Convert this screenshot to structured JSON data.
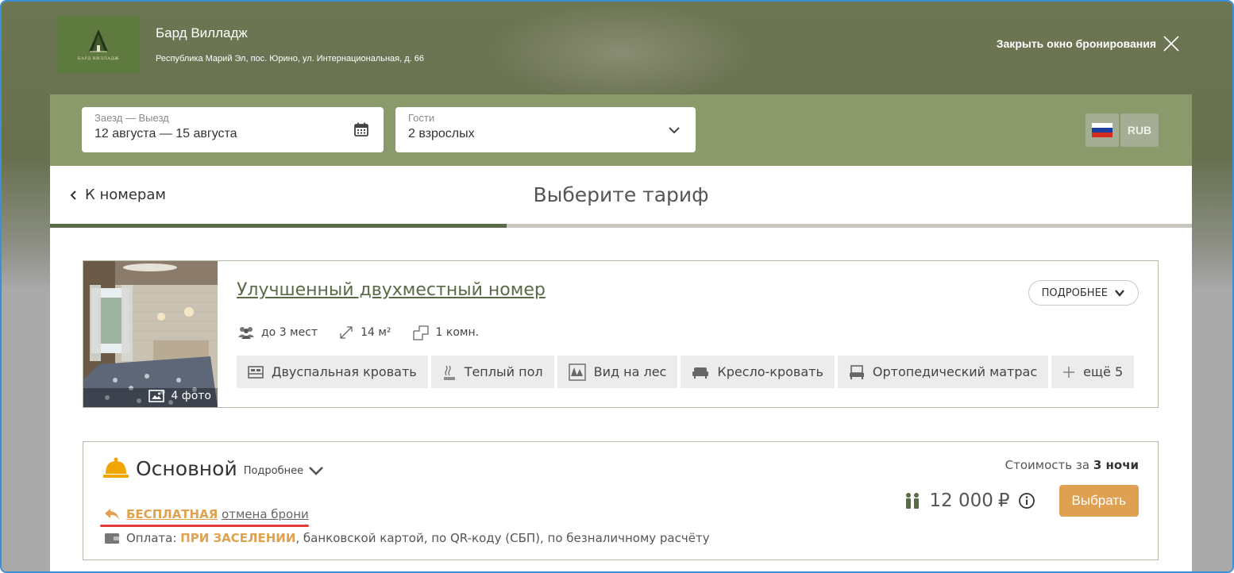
{
  "hotel": {
    "name": "Бард Вилладж",
    "address": "Республика Марий Эл, пос. Юрино, ул. Интернациональная, д. 66",
    "logo_text": "БАРД ВИЛЛАДЖ"
  },
  "header": {
    "close_label": "Закрыть окно бронирования"
  },
  "search": {
    "dates_label": "Заезд — Выезд",
    "dates_value": "12 августа — 15 августа",
    "guests_label": "Гости",
    "guests_value": "2 взрослых",
    "currency": "RUB"
  },
  "nav": {
    "back_label": "К номерам",
    "step_title": "Выберите тариф"
  },
  "room": {
    "title": "Улучшенный двухместный номер",
    "more_label": "ПОДРОБНЕЕ",
    "photo_count": "4 фото",
    "capacity": "до 3 мест",
    "area": "14 м²",
    "rooms": "1 комн.",
    "amenities": [
      {
        "icon": "bed-icon",
        "label": "Двуспальная кровать"
      },
      {
        "icon": "warm-floor-icon",
        "label": "Теплый пол"
      },
      {
        "icon": "forest-view-icon",
        "label": "Вид на лес"
      },
      {
        "icon": "sofa-bed-icon",
        "label": "Кресло-кровать"
      },
      {
        "icon": "mattress-icon",
        "label": "Ортопедический матрас"
      },
      {
        "icon": "plus-icon",
        "label": "ещё 5"
      }
    ]
  },
  "tariff": {
    "name": "Основной",
    "more_label": "Подробнее",
    "cancel_strong": "БЕСПЛАТНАЯ",
    "cancel_rest": "отмена брони",
    "payment_prefix": "Оплата:",
    "payment_strong": "ПРИ ЗАСЕЛЕНИИ",
    "payment_rest": ", банковской картой, по QR-коду (СБП), по безналичному расчёту",
    "price_label_prefix": "Стоимость за",
    "price_label_nights": "3 ночи",
    "price": "12 000",
    "currency_symbol": "₽",
    "select_label": "Выбрать"
  },
  "colors": {
    "accent": "#dfa151",
    "header_bg": "#6d7653",
    "search_bg": "#8b9a6a",
    "brand_green": "#5b6b47",
    "alert_red": "#e23b3b"
  }
}
